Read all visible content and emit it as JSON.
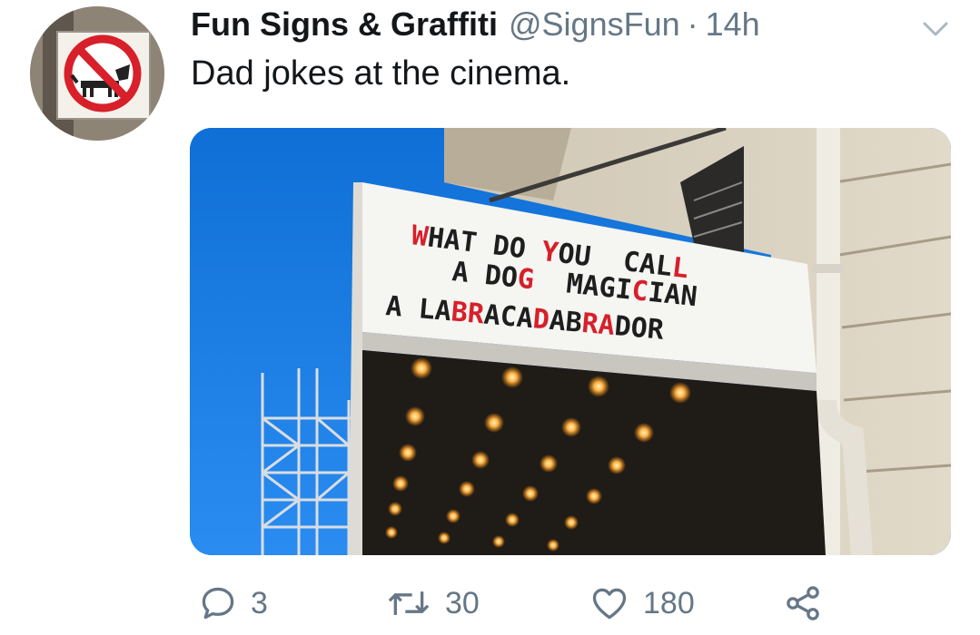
{
  "tweet": {
    "display_name": "Fun Signs & Graffiti",
    "handle": "@SignsFun",
    "separator": "·",
    "time": "14h",
    "text": "Dad jokes at the cinema."
  },
  "marquee": {
    "line1": [
      "WHAT",
      "DO",
      "YOU",
      "CALL"
    ],
    "line2": [
      "A",
      "DOG",
      "MAGICIAN"
    ],
    "line3": [
      "A",
      "LABRACADABRADOR"
    ]
  },
  "actions": {
    "replies": "3",
    "retweets": "30",
    "likes": "180"
  },
  "colors": {
    "text": "#14171a",
    "secondary": "#657786",
    "sky": "#1da1f2"
  },
  "icons": {
    "reply": "reply-icon",
    "retweet": "retweet-icon",
    "like": "heart-icon",
    "share": "share-icon",
    "menu": "chevron-down-icon"
  }
}
